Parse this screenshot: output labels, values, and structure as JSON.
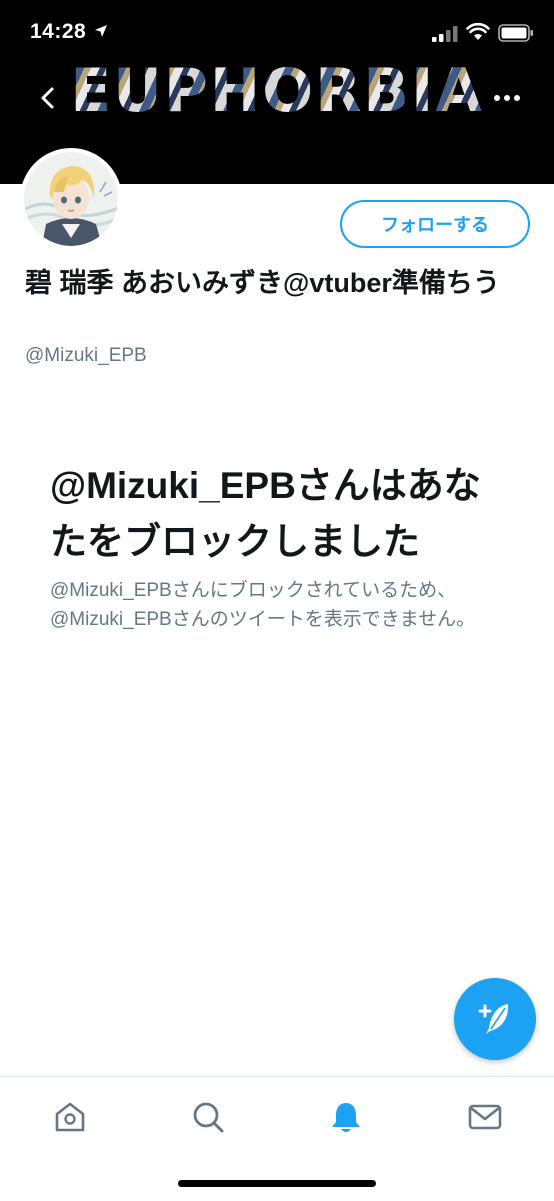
{
  "status_bar": {
    "time": "14:28",
    "icons": [
      "location-arrow-icon",
      "cellular-signal-icon",
      "wifi-icon",
      "battery-icon"
    ]
  },
  "header": {
    "banner_text": "EUPHORBIA",
    "back_icon": "chevron-left-icon",
    "more_icon": "more-horizontal-icon"
  },
  "profile": {
    "follow_label": "フォローする",
    "display_name": "碧 瑞季 あおいみずき@vtuber準備ちう",
    "handle": "@Mizuki_EPB"
  },
  "blocked": {
    "title": "@Mizuki_EPBさんはあなたをブロックしました",
    "description": "@Mizuki_EPBさんにブロックされているため、@Mizuki_EPBさんのツイートを表示できません。"
  },
  "fab": {
    "icon": "compose-tweet-icon"
  },
  "tab_bar": {
    "tabs": [
      "home-icon",
      "search-icon",
      "notifications-bell-icon",
      "messages-mail-icon"
    ],
    "active": "notifications-bell-icon"
  },
  "colors": {
    "accent": "#1da1f2",
    "header_background": "#000000",
    "secondary_text": "#657786",
    "primary_text": "#14171a"
  }
}
